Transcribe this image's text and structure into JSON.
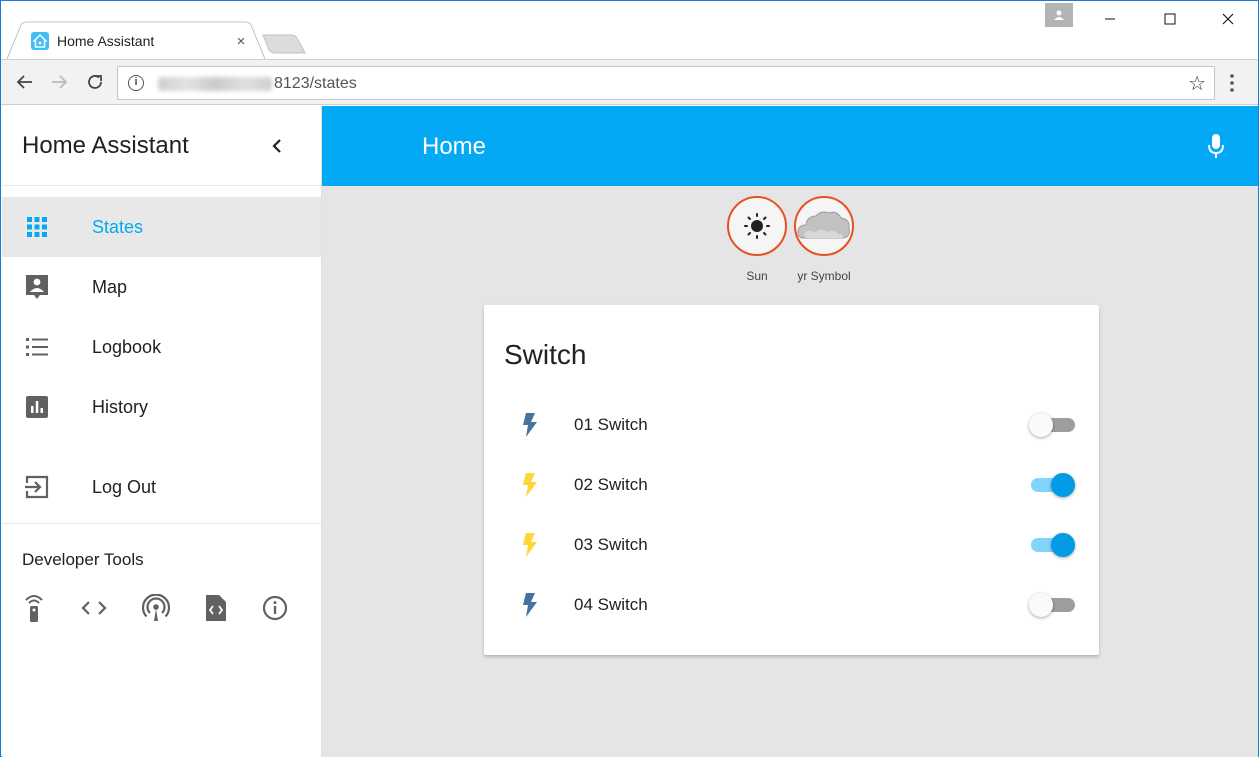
{
  "browser": {
    "tab_title": "Home Assistant",
    "tab_close": "×",
    "url_suffix": "8123/states",
    "back": "←",
    "forward": "→",
    "reload": "↻",
    "info": "i",
    "star": "☆"
  },
  "window_controls": {
    "minimize": "—",
    "maximize": "☐",
    "close": "✕"
  },
  "sidebar": {
    "title": "Home Assistant",
    "items": [
      {
        "label": "States",
        "icon": "grid-icon",
        "active": true
      },
      {
        "label": "Map",
        "icon": "map-pin-icon"
      },
      {
        "label": "Logbook",
        "icon": "list-icon"
      },
      {
        "label": "History",
        "icon": "chart-icon"
      },
      {
        "label": "Log Out",
        "icon": "logout-icon"
      }
    ],
    "dev_tools_title": "Developer Tools",
    "dev_tools": [
      "remote-icon",
      "code-icon",
      "broadcast-icon",
      "template-file-icon",
      "info-icon"
    ]
  },
  "header": {
    "title": "Home"
  },
  "badges": [
    {
      "label": "Sun",
      "icon": "sun-icon"
    },
    {
      "label": "yr Symbol",
      "icon": "cloud-icon"
    }
  ],
  "card": {
    "title": "Switch",
    "entities": [
      {
        "name": "01 Switch",
        "on": false
      },
      {
        "name": "02 Switch",
        "on": true
      },
      {
        "name": "03 Switch",
        "on": true
      },
      {
        "name": "04 Switch",
        "on": false
      }
    ]
  },
  "colors": {
    "accent": "#03a9f4",
    "bolt_off": "#44739e",
    "bolt_on": "#fdd835",
    "toggle_on_knob": "#039be5",
    "toggle_on_track": "#81d4fa",
    "toggle_off_knob": "#fafafa",
    "toggle_off_track": "#9e9e9e",
    "badge_border": "#e65124"
  }
}
